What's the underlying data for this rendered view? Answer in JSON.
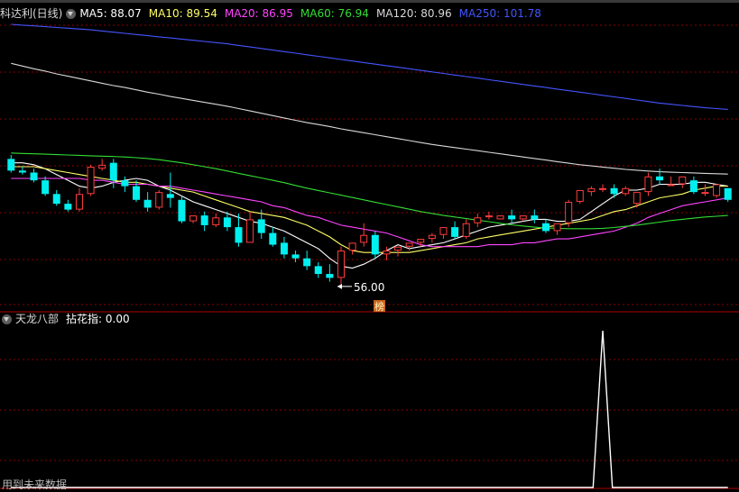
{
  "header": {
    "stock_name": "科达利(日线)"
  },
  "ma_legend": [
    {
      "label": "MA5: 88.07",
      "color": "#ffffff"
    },
    {
      "label": "MA10: 89.54",
      "color": "#ffff66"
    },
    {
      "label": "MA20: 86.95",
      "color": "#ff44ff"
    },
    {
      "label": "MA60: 76.94",
      "color": "#33dd33"
    },
    {
      "label": "MA120: 80.96",
      "color": "#d8d8d8"
    },
    {
      "label": "MA250: 101.78",
      "color": "#4455ff"
    }
  ],
  "indicator": {
    "name": "天龙八部",
    "value_label": "拈花指: 0.00"
  },
  "footer": {
    "note": "用到未来数据"
  },
  "annotations": {
    "low_marker": "56.00",
    "badge": "榜"
  },
  "colors": {
    "background": "#000000",
    "grid": "#8a0000",
    "up": "#ff3c3c",
    "down": "#00f0f0",
    "separator": "#b00000",
    "badge_bg": "#c8641e"
  },
  "chart_data": [
    {
      "type": "candlestick",
      "y_range": [
        52,
        122
      ],
      "candles": [
        [
          87.5,
          88.5,
          84.5,
          84
        ],
        [
          84.5,
          85.5,
          84,
          83.5
        ],
        [
          84,
          85,
          82,
          81.5
        ],
        [
          82,
          83,
          78.5,
          78
        ],
        [
          78.5,
          79.5,
          76,
          75.5
        ],
        [
          76,
          77,
          74.5,
          74
        ],
        [
          74.5,
          80,
          78.5,
          74
        ],
        [
          78.5,
          86,
          85.5,
          78
        ],
        [
          85,
          87.5,
          86,
          84.5
        ],
        [
          86.5,
          87.5,
          82,
          80
        ],
        [
          82,
          83,
          80.5,
          79
        ],
        [
          80.5,
          82,
          77,
          76.5
        ],
        [
          77,
          79,
          75,
          74
        ],
        [
          75,
          79.5,
          79,
          74.5
        ],
        [
          78.5,
          84,
          77.5,
          75
        ],
        [
          77,
          78,
          71.5,
          71
        ],
        [
          71.5,
          73,
          73,
          71
        ],
        [
          73,
          74,
          70.5,
          69
        ],
        [
          70.5,
          73.5,
          72.5,
          70
        ],
        [
          72.5,
          74,
          70,
          69
        ],
        [
          70,
          73.5,
          66,
          65
        ],
        [
          66,
          74,
          72,
          70
        ],
        [
          72,
          74.5,
          68.5,
          67
        ],
        [
          68.5,
          70,
          65.5,
          65
        ],
        [
          66,
          67.5,
          63,
          62
        ],
        [
          63,
          64,
          62,
          61
        ],
        [
          62,
          64,
          60,
          59
        ],
        [
          60,
          61,
          58,
          57
        ],
        [
          58,
          60.5,
          57,
          56
        ],
        [
          57,
          65,
          64,
          55.5
        ],
        [
          64,
          66,
          66,
          63
        ],
        [
          66,
          71,
          68,
          65
        ],
        [
          68,
          69,
          63,
          62
        ],
        [
          63,
          65,
          64,
          61.5
        ],
        [
          64,
          65,
          65,
          62.5
        ],
        [
          65,
          66,
          66,
          64
        ],
        [
          66,
          67,
          67,
          65
        ],
        [
          67,
          68.5,
          68,
          66
        ],
        [
          68,
          70,
          70,
          67
        ],
        [
          70,
          71.5,
          67.5,
          67
        ],
        [
          67.5,
          72,
          71,
          67
        ],
        [
          71,
          73.5,
          72.5,
          70
        ],
        [
          73,
          74,
          73,
          72
        ],
        [
          72,
          73,
          73,
          72
        ],
        [
          73,
          74.5,
          72,
          71
        ],
        [
          72,
          73,
          73,
          71.5
        ],
        [
          73,
          74.5,
          72,
          71
        ],
        [
          71,
          72,
          69,
          68.5
        ],
        [
          69,
          70.5,
          71,
          68
        ],
        [
          71,
          77,
          76.5,
          70
        ],
        [
          76.5,
          77.5,
          79.5,
          76
        ],
        [
          79,
          80.5,
          80,
          78
        ],
        [
          80,
          81,
          80,
          79
        ],
        [
          80,
          81,
          78.5,
          77.5
        ],
        [
          78.5,
          80.5,
          80,
          78
        ],
        [
          76,
          77.5,
          79,
          75
        ],
        [
          79,
          84,
          83,
          78
        ],
        [
          83,
          85,
          82,
          81
        ],
        [
          81,
          83,
          81,
          81
        ],
        [
          81,
          83,
          83,
          80
        ],
        [
          82,
          83,
          79,
          78.5
        ],
        [
          79,
          81,
          79,
          78
        ],
        [
          78,
          80,
          81,
          77.5
        ],
        [
          80,
          80,
          77,
          76.5
        ]
      ],
      "moving_averages": [
        {
          "name": "MA5",
          "color": "#ffffff",
          "values": [
            86.5,
            86.5,
            86,
            85,
            83.5,
            82,
            80.5,
            80,
            80.5,
            81.5,
            82,
            82.5,
            82,
            80.5,
            79.5,
            78,
            76.5,
            75.5,
            74.5,
            73.5,
            72.5,
            71.5,
            71,
            70,
            69,
            67.5,
            66,
            64.5,
            62,
            60,
            59.5,
            60.5,
            62,
            64,
            65.5,
            64.5,
            65,
            65.5,
            66,
            67,
            68,
            69,
            70,
            70.5,
            71,
            71.5,
            72,
            72,
            71.5,
            71.5,
            72,
            74,
            76,
            78,
            79.5,
            79.5,
            80,
            81,
            81,
            81,
            81.5,
            81.5,
            81,
            80.5
          ]
        },
        {
          "name": "MA10",
          "color": "#ffff66",
          "values": [
            85.5,
            85.5,
            85.5,
            85,
            84.5,
            84,
            83.5,
            83,
            82.5,
            82,
            81.5,
            81.5,
            81,
            80.5,
            80,
            79.5,
            79,
            78,
            77,
            76,
            75,
            74,
            73.5,
            73,
            72.5,
            71.5,
            70.5,
            69,
            67.5,
            65.5,
            64,
            63.5,
            63.5,
            63.5,
            63.5,
            63.5,
            64,
            64.5,
            65,
            65.5,
            66,
            67,
            67.5,
            68,
            68.5,
            69,
            69.5,
            70,
            70.5,
            71,
            71.5,
            72,
            73,
            74,
            74.5,
            75.5,
            76.5,
            77.5,
            78,
            78.5,
            79.5,
            80,
            80.5,
            80.5
          ]
        },
        {
          "name": "MA20",
          "color": "#ff44ff",
          "values": [
            82.5,
            82.5,
            82.5,
            82.5,
            82.5,
            82.5,
            82.5,
            82,
            82,
            81.5,
            81,
            81,
            81,
            80.5,
            80.5,
            80,
            79.5,
            79,
            78.5,
            78,
            77.5,
            77,
            76.5,
            75.5,
            75,
            74,
            73,
            72.5,
            71.5,
            70.5,
            70,
            69.5,
            69,
            68.5,
            67.5,
            66.5,
            65.5,
            65,
            65,
            65,
            65,
            65,
            65.5,
            65.5,
            65.5,
            66,
            66,
            66.5,
            67,
            67,
            67.5,
            68,
            68.5,
            69,
            70,
            71,
            72.5,
            73.5,
            74.5,
            75.5,
            76,
            76.5,
            77,
            77.5
          ]
        },
        {
          "name": "MA60",
          "color": "#33dd33",
          "values": [
            89,
            88.9,
            88.8,
            88.7,
            88.6,
            88.5,
            88.4,
            88.3,
            88.2,
            88.1,
            88,
            87.8,
            87.6,
            87.3,
            86.9,
            86.5,
            86,
            85.5,
            85,
            84.4,
            83.8,
            83.2,
            82.6,
            82,
            81.4,
            80.7,
            80,
            79.4,
            78.8,
            78.2,
            77.6,
            77,
            76.4,
            75.8,
            75.2,
            74.6,
            74,
            73.5,
            73,
            72.6,
            72.2,
            71.8,
            71.4,
            71,
            70.6,
            70.3,
            70,
            69.8,
            69.7,
            69.6,
            69.6,
            69.6,
            69.7,
            69.9,
            70.2,
            70.5,
            70.9,
            71.3,
            71.7,
            72,
            72.3,
            72.6,
            72.8,
            73
          ]
        },
        {
          "name": "MA120",
          "color": "#d8d8d8",
          "values": [
            112,
            111.3,
            110.6,
            110,
            109.3,
            108.7,
            108.1,
            107.5,
            106.9,
            106.3,
            105.8,
            105.2,
            104.6,
            104.1,
            103.5,
            103,
            102.5,
            102,
            101.5,
            101,
            100.4,
            99.8,
            99.2,
            98.6,
            98,
            97.4,
            96.8,
            96.3,
            95.8,
            95.2,
            94.7,
            94.2,
            93.7,
            93.2,
            92.7,
            92.2,
            91.7,
            91.2,
            90.8,
            90.4,
            90,
            89.6,
            89.2,
            88.8,
            88.4,
            88,
            87.6,
            87.2,
            86.8,
            86.4,
            86,
            85.7,
            85.4,
            85.1,
            84.8,
            84.6,
            84.4,
            84.2,
            84.1,
            84,
            83.9,
            83.8,
            83.7,
            83.6
          ]
        },
        {
          "name": "MA250",
          "color": "#4455ff",
          "values": [
            122,
            121.8,
            121.6,
            121.4,
            121.2,
            121,
            120.8,
            120.6,
            120.3,
            120,
            119.7,
            119.4,
            119.1,
            118.8,
            118.5,
            118.2,
            117.9,
            117.6,
            117.3,
            117,
            116.6,
            116.2,
            115.8,
            115.4,
            115,
            114.6,
            114.2,
            113.8,
            113.4,
            113,
            112.6,
            112.2,
            111.8,
            111.4,
            111,
            110.6,
            110.2,
            109.8,
            109.4,
            109,
            108.6,
            108.2,
            107.8,
            107.4,
            107,
            106.6,
            106.2,
            105.8,
            105.4,
            105,
            104.6,
            104.2,
            103.8,
            103.4,
            103,
            102.6,
            102.2,
            101.8,
            101.5,
            101.2,
            100.9,
            100.6,
            100.4,
            100.2
          ]
        }
      ]
    },
    {
      "type": "line",
      "name": "拈花指",
      "y_range": [
        0,
        1
      ],
      "values": [
        0,
        0,
        0,
        0,
        0,
        0,
        0,
        0,
        0,
        0,
        0,
        0,
        0,
        0,
        0,
        0,
        0,
        0,
        0,
        0,
        0,
        0,
        0,
        0,
        0,
        0,
        0,
        0,
        0,
        0,
        0,
        0,
        0,
        0,
        0,
        0,
        0,
        0,
        0,
        0,
        0,
        0,
        0,
        0,
        0,
        0,
        0,
        0,
        0,
        0,
        0,
        0,
        1,
        0,
        0,
        0,
        0,
        0,
        0,
        0,
        0,
        0,
        0,
        0
      ]
    }
  ]
}
